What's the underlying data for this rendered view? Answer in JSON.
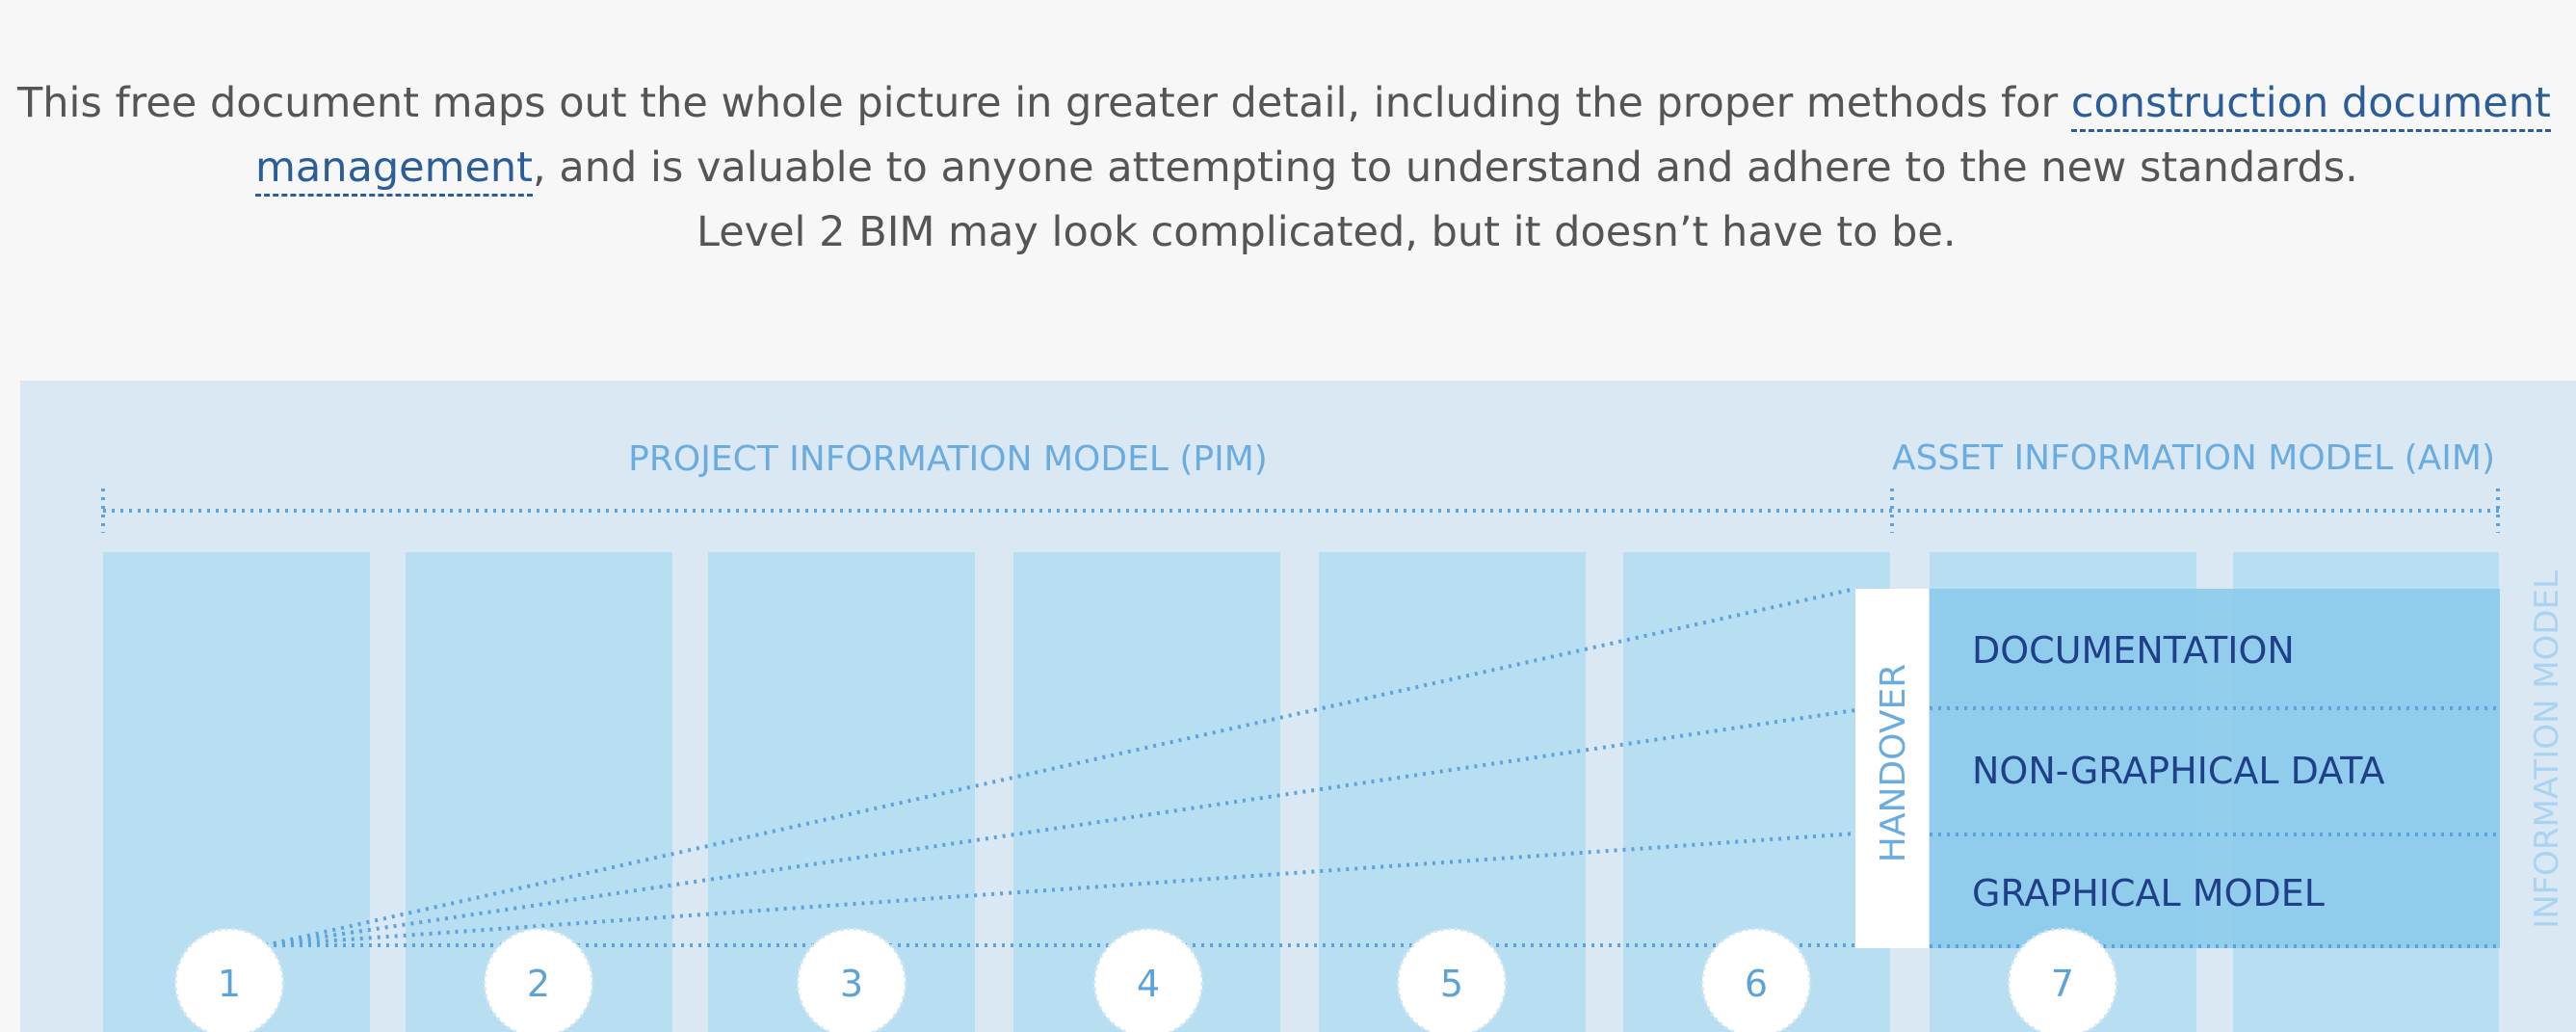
{
  "intro": {
    "line1_text": "This free document maps out the whole picture in greater detail, including the proper methods for ",
    "link_part1": "construction document",
    "link_part2": "management",
    "line2_text": ", and is valuable to anyone attempting to understand and adhere to the new standards.",
    "line3_text": "Level 2 BIM may look complicated, but it doesn’t have to be."
  },
  "diagram": {
    "pim_label": "PROJECT INFORMATION MODEL (PIM)",
    "aim_label": "ASSET INFORMATION MODEL (AIM)",
    "handover_label": "HANDOVER",
    "layers": [
      "DOCUMENTATION",
      "NON-GRAPHICAL DATA",
      "GRAPHICAL MODEL"
    ],
    "side_label": "INFORMATION MODEL",
    "stages": [
      "1",
      "2",
      "3",
      "4",
      "5",
      "6",
      "7"
    ],
    "colors": {
      "background": "#dae8f4",
      "column": "#b8def1",
      "column_dim": "#c4e2f2",
      "layers_block": "#8ccbec",
      "accent_line": "#5ca3db",
      "label_light": "#6aace0",
      "label_dark": "#1f3f88"
    }
  }
}
